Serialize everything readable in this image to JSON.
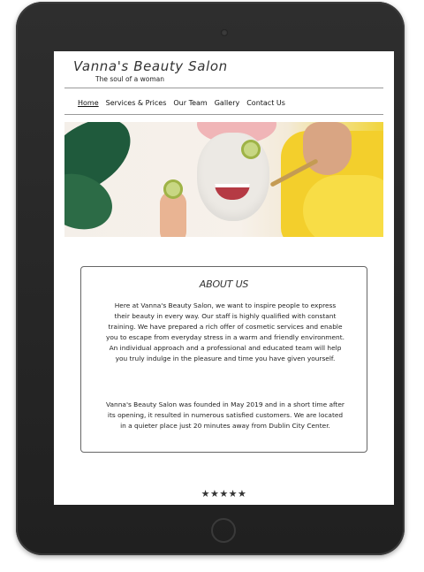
{
  "site": {
    "title": "Vanna's Beauty Salon",
    "tagline": "The soul of a woman"
  },
  "nav": {
    "items": [
      {
        "label": "Home",
        "active": true
      },
      {
        "label": "Services & Prices",
        "active": false
      },
      {
        "label": "Our Team",
        "active": false
      },
      {
        "label": "Gallery",
        "active": false
      },
      {
        "label": "Contact Us",
        "active": false
      }
    ]
  },
  "hero": {
    "image": "woman-facial-mask-cucumber-photo"
  },
  "about": {
    "title": "ABOUT US",
    "paragraph1": "Here at Vanna's Beauty Salon, we want to inspire people to express their beauty in every way. Our staff is highly qualified with constant training. We have prepared a rich offer of cosmetic services and enable you to escape from everyday stress in a warm and friendly environment. An individual approach and a professional and educated team will help you truly indulge in the pleasure and time you have given yourself.",
    "paragraph2": "Vanna's Beauty Salon was founded in May 2019 and in a short time after its opening, it resulted in numerous satisfied customers. We are located in a quieter place just 20 minutes away from Dublin City Center."
  },
  "rating": {
    "stars": "★★★★★",
    "value": 5,
    "max": 5
  },
  "colors": {
    "device": "#262626",
    "text": "#222222",
    "towel": "#f3cf2c"
  }
}
